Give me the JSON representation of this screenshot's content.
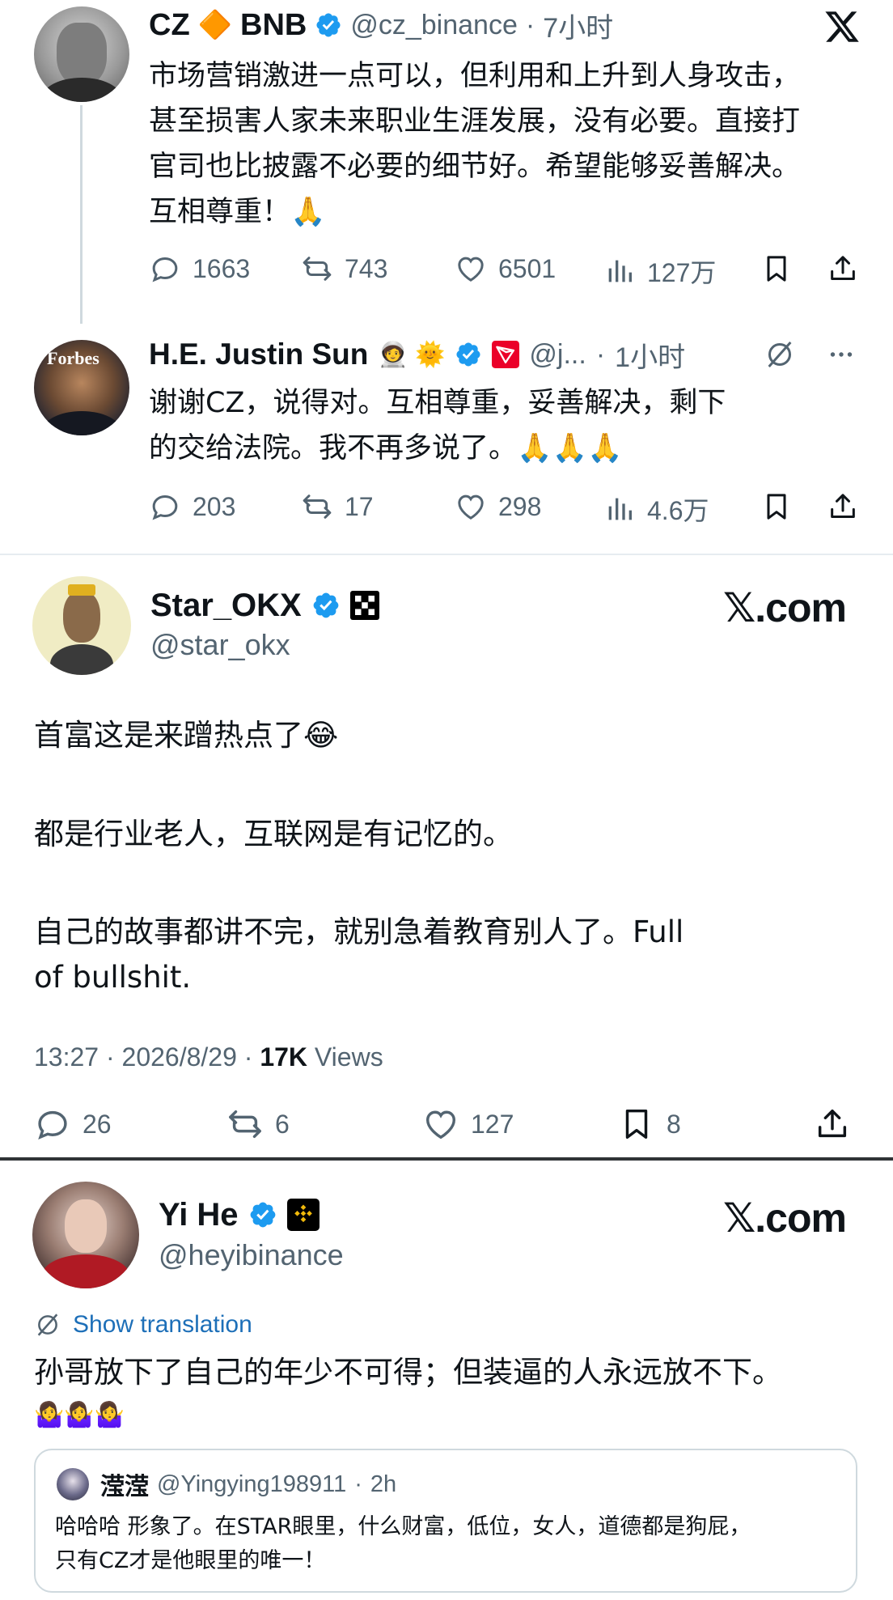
{
  "tweet1": {
    "name": "CZ",
    "diamond": "🔶",
    "suffix": "BNB",
    "handle": "@cz_binance",
    "sep": "·",
    "time": "7小时",
    "text_lines": [
      "市场营销激进一点可以，但利用和上升到人身攻击，",
      "甚至损害人家未来职业生涯发展，没有必要。直接打",
      "官司也比披露不必要的细节好。希望能够妥善解决。",
      "互相尊重！🙏"
    ],
    "replies": "1663",
    "retweets": "743",
    "likes": "6501",
    "views": "127万"
  },
  "tweet2": {
    "name": "H.E. Justin Sun",
    "emojis": "🧑‍🚀 🌞",
    "avatar_text": "Forbes",
    "handle": "@j...",
    "sep": "·",
    "time": "1小时",
    "text_lines": [
      "谢谢CZ，说得对。互相尊重，妥善解决，剩下",
      "的交给法院。我不再多说了。🙏🙏🙏"
    ],
    "replies": "203",
    "retweets": "17",
    "likes": "298",
    "views": "4.6万"
  },
  "tweet3": {
    "name": "Star_OKX",
    "handle": "@star_okx",
    "brand": "𝕏.com",
    "paragraphs": [
      "首富这是来蹭热点了😂",
      "都是行业老人，互联网是有记忆的。",
      "自己的故事都讲不完，就别急着教育别人了。Full",
      "of bullshit."
    ],
    "meta_time": "13:27 · 2026/8/29 · ",
    "meta_views_count": "17K",
    "meta_views_label": " Views",
    "replies": "26",
    "retweets": "6",
    "likes": "127",
    "bookmarks": "8"
  },
  "tweet4": {
    "name": "Yi He",
    "handle": "@heyibinance",
    "brand": "𝕏.com",
    "show_translation": "Show translation",
    "text": "孙哥放下了自己的年少不可得；但装逼的人永远放不下。",
    "emoji_line": "🤷‍♀️🤷‍♀️🤷‍♀️",
    "quote": {
      "name": "滢滢",
      "handle": "@Yingying198911",
      "sep": "·",
      "time": "2h",
      "lines": [
        "哈哈哈 形象了。在STAR眼里，什么财富，低位，女人，道德都是狗屁，",
        "只有CZ才是他眼里的唯一！"
      ]
    }
  },
  "colors": {
    "verified": "#1d9bf0",
    "text": "#0f1419",
    "secondary": "#536471",
    "divider": "#cfd9de",
    "tron_red": "#eb0029",
    "binance_gold": "#f0b90b"
  }
}
